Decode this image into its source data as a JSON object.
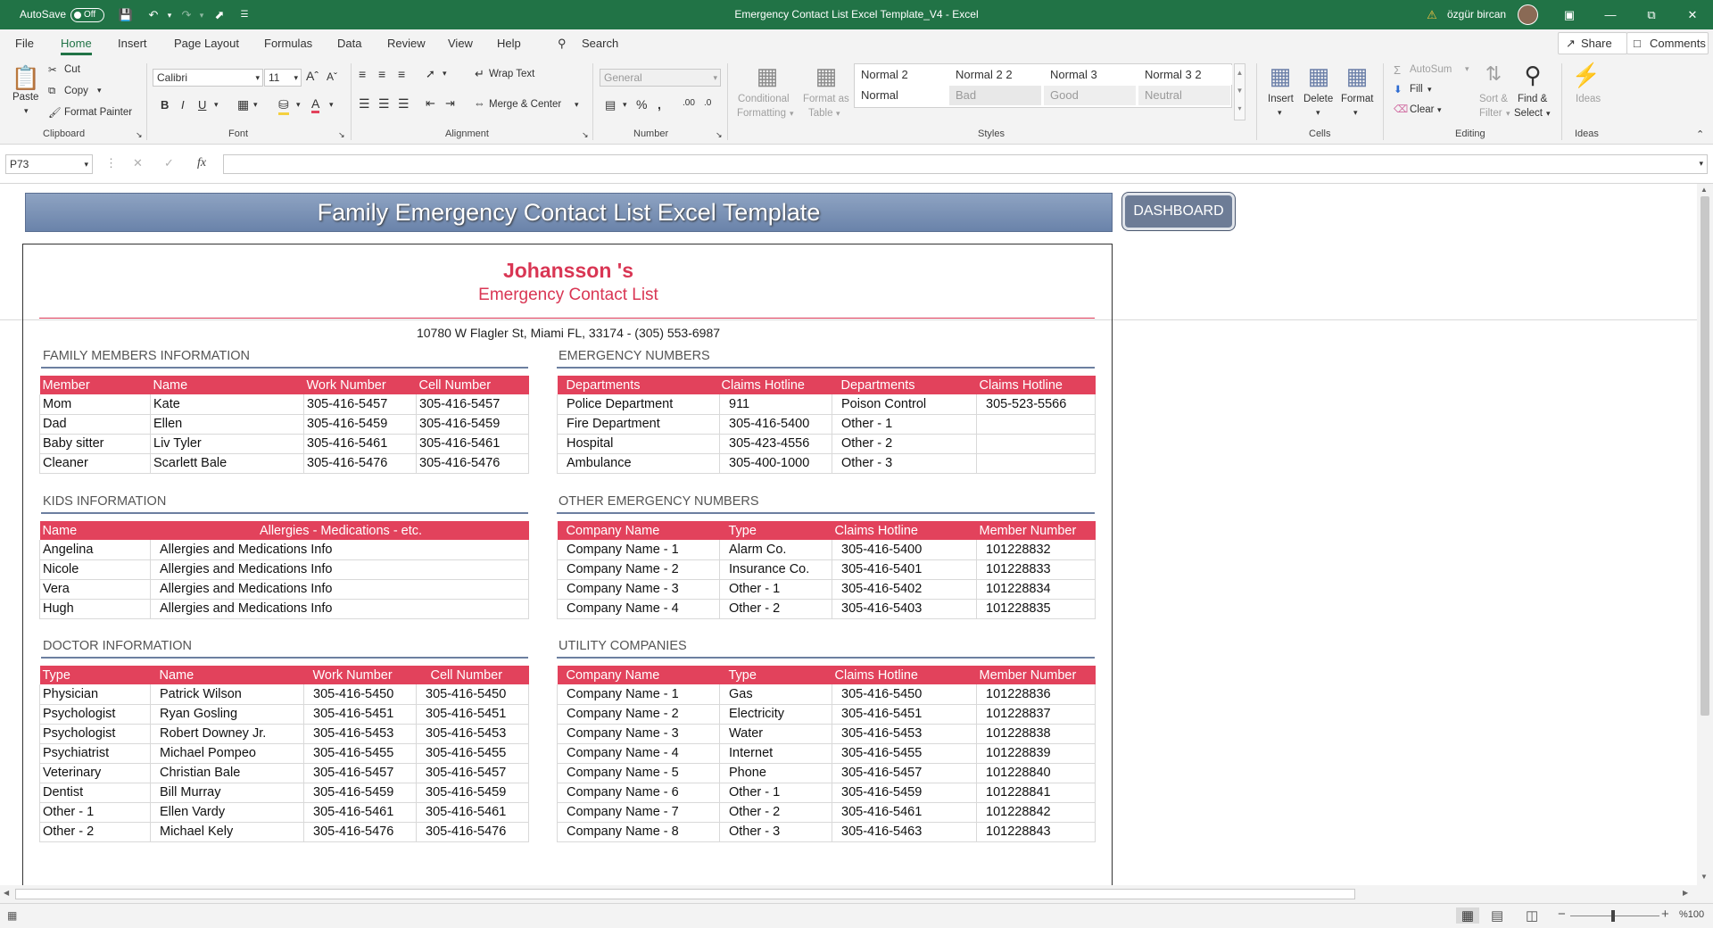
{
  "titlebar": {
    "autosave_label": "AutoSave",
    "autosave_state": "Off",
    "doc_title": "Emergency Contact List Excel Template_V4  -  Excel",
    "user_name": "özgür bircan"
  },
  "menu": {
    "tabs": [
      "File",
      "Home",
      "Insert",
      "Page Layout",
      "Formulas",
      "Data",
      "Review",
      "View",
      "Help"
    ],
    "search": "Search",
    "share": "Share",
    "comments": "Comments"
  },
  "ribbon": {
    "clipboard": {
      "paste": "Paste",
      "cut": "Cut",
      "copy": "Copy",
      "format_painter": "Format Painter",
      "label": "Clipboard"
    },
    "font": {
      "name": "Calibri",
      "size": "11",
      "label": "Font"
    },
    "alignment": {
      "wrap_text": "Wrap Text",
      "merge_center": "Merge & Center",
      "label": "Alignment"
    },
    "number": {
      "format": "General",
      "label": "Number"
    },
    "styles": {
      "conditional": [
        "Conditional",
        "Formatting"
      ],
      "format_table": [
        "Format as",
        "Table"
      ],
      "cells": [
        {
          "name": "Normal 2",
          "bg": "#ffffff",
          "color": "#333333"
        },
        {
          "name": "Normal 2 2",
          "bg": "#ffffff",
          "color": "#333333"
        },
        {
          "name": "Normal 3",
          "bg": "#ffffff",
          "color": "#333333"
        },
        {
          "name": "Normal 3 2",
          "bg": "#ffffff",
          "color": "#333333"
        },
        {
          "name": "Normal",
          "bg": "#ffffff",
          "color": "#333333"
        },
        {
          "name": "Bad",
          "bg": "#e8e8e8",
          "color": "#9a9a9a"
        },
        {
          "name": "Good",
          "bg": "#eeeeee",
          "color": "#9a9a9a"
        },
        {
          "name": "Neutral",
          "bg": "#eeeeee",
          "color": "#9a9a9a"
        }
      ],
      "label": "Styles"
    },
    "cells": {
      "insert": "Insert",
      "delete": "Delete",
      "format": "Format",
      "label": "Cells"
    },
    "editing": {
      "autosum": "AutoSum",
      "fill": "Fill",
      "clear": "Clear",
      "sort_filter": [
        "Sort &",
        "Filter"
      ],
      "find_select": [
        "Find &",
        "Select"
      ],
      "label": "Editing"
    },
    "ideas": {
      "label": "Ideas",
      "button": "Ideas"
    }
  },
  "formula_bar": {
    "name_box": "P73",
    "fx": "fx",
    "value": ""
  },
  "sheet": {
    "banner_title": "Family Emergency Contact List Excel Template",
    "dashboard_button": "DASHBOARD",
    "family_name": "Johansson 's",
    "subtitle": "Emergency Contact List",
    "address": "10780 W Flagler St, Miami FL, 33174 - (305) 553-6987",
    "family": {
      "title": "FAMILY MEMBERS INFORMATION",
      "headers": [
        "Member",
        "Name",
        "Work Number",
        "Cell Number"
      ],
      "rows": [
        [
          "Mom",
          "Kate",
          "305-416-5457",
          "305-416-5457"
        ],
        [
          "Dad",
          "Ellen",
          "305-416-5459",
          "305-416-5459"
        ],
        [
          "Baby sitter",
          "Liv Tyler",
          "305-416-5461",
          "305-416-5461"
        ],
        [
          "Cleaner",
          "Scarlett Bale",
          "305-416-5476",
          "305-416-5476"
        ]
      ]
    },
    "emergency": {
      "title": "EMERGENCY NUMBERS",
      "headers": [
        "Departments",
        "Claims Hotline",
        "Departments",
        "Claims Hotline"
      ],
      "rows": [
        [
          "Police Department",
          "911",
          "Poison Control",
          "305-523-5566"
        ],
        [
          "Fire Department",
          "305-416-5400",
          "Other - 1",
          ""
        ],
        [
          "Hospital",
          "305-423-4556",
          "Other - 2",
          ""
        ],
        [
          "Ambulance",
          "305-400-1000",
          "Other - 3",
          ""
        ]
      ]
    },
    "kids": {
      "title": "KIDS INFORMATION",
      "headers": [
        "Name",
        "Allergies - Medications - etc."
      ],
      "rows": [
        [
          "Angelina",
          "Allergies and Medications Info"
        ],
        [
          "Nicole",
          "Allergies and Medications Info"
        ],
        [
          "Vera",
          "Allergies and Medications Info"
        ],
        [
          "Hugh",
          "Allergies and Medications Info"
        ]
      ]
    },
    "other_emergency": {
      "title": "OTHER EMERGENCY NUMBERS",
      "headers": [
        "Company Name",
        "Type",
        "Claims Hotline",
        "Member  Number"
      ],
      "rows": [
        [
          "Company Name - 1",
          "Alarm Co.",
          "305-416-5400",
          "101228832"
        ],
        [
          "Company Name - 2",
          "Insurance Co.",
          "305-416-5401",
          "101228833"
        ],
        [
          "Company Name - 3",
          "Other - 1",
          "305-416-5402",
          "101228834"
        ],
        [
          "Company Name - 4",
          "Other - 2",
          "305-416-5403",
          "101228835"
        ]
      ]
    },
    "doctor": {
      "title": "DOCTOR INFORMATION",
      "headers": [
        "Type",
        "Name",
        "Work Number",
        "Cell Number"
      ],
      "rows": [
        [
          "Physician",
          "Patrick Wilson",
          "305-416-5450",
          "305-416-5450"
        ],
        [
          "Psychologist",
          "Ryan Gosling",
          "305-416-5451",
          "305-416-5451"
        ],
        [
          "Psychologist",
          "Robert Downey Jr.",
          "305-416-5453",
          "305-416-5453"
        ],
        [
          "Psychiatrist",
          "Michael Pompeo",
          "305-416-5455",
          "305-416-5455"
        ],
        [
          "Veterinary",
          "Christian Bale",
          "305-416-5457",
          "305-416-5457"
        ],
        [
          "Dentist",
          "Bill Murray",
          "305-416-5459",
          "305-416-5459"
        ],
        [
          "Other - 1",
          "Ellen Vardy",
          "305-416-5461",
          "305-416-5461"
        ],
        [
          "Other - 2",
          "Michael Kely",
          "305-416-5476",
          "305-416-5476"
        ]
      ]
    },
    "utility": {
      "title": "UTILITY COMPANIES",
      "headers": [
        "Company Name",
        "Type",
        "Claims Hotline",
        "Member Number"
      ],
      "rows": [
        [
          "Company Name - 1",
          "Gas",
          "305-416-5450",
          "101228836"
        ],
        [
          "Company Name - 2",
          "Electricity",
          "305-416-5451",
          "101228837"
        ],
        [
          "Company Name - 3",
          "Water",
          "305-416-5453",
          "101228838"
        ],
        [
          "Company Name - 4",
          "Internet",
          "305-416-5455",
          "101228839"
        ],
        [
          "Company Name - 5",
          "Phone",
          "305-416-5457",
          "101228840"
        ],
        [
          "Company Name - 6",
          "Other - 1",
          "305-416-5459",
          "101228841"
        ],
        [
          "Company Name - 7",
          "Other - 2",
          "305-416-5461",
          "101228842"
        ],
        [
          "Company Name - 8",
          "Other - 3",
          "305-416-5463",
          "101228843"
        ]
      ]
    }
  },
  "status": {
    "zoom": "%100"
  },
  "colors": {
    "excel_green": "#217346",
    "accent_red": "#e2425c",
    "title_red": "#d93654",
    "banner_blue": "#7b90b4"
  }
}
